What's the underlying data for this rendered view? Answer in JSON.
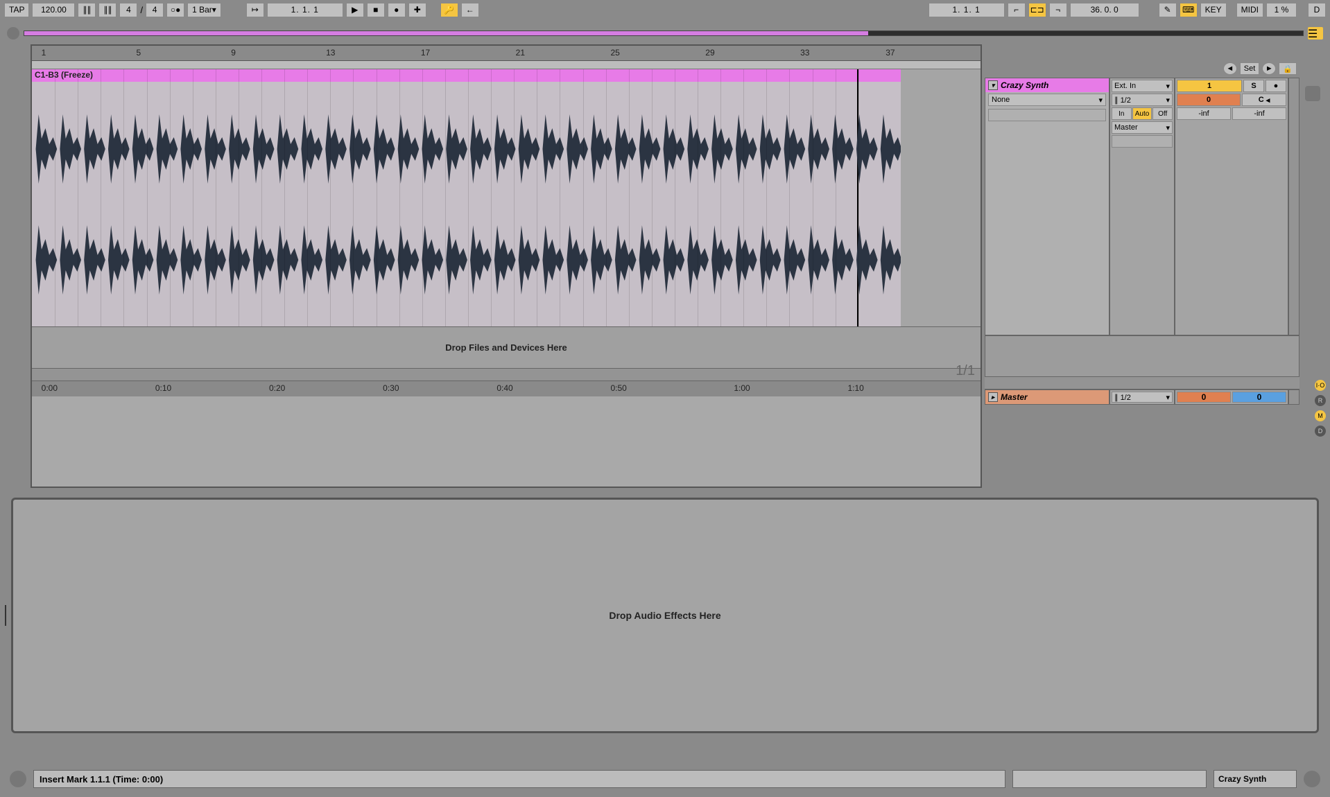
{
  "topbar": {
    "tap": "TAP",
    "tempo": "120.00",
    "sig_num": "4",
    "sig_sep": "/",
    "sig_den": "4",
    "quantize": "1 Bar",
    "position": "1.   1.   1",
    "position2": "1.   1.   1",
    "bars": "36.   0.   0",
    "key": "KEY",
    "midi": "MIDI",
    "pct": "1 %",
    "d": "D"
  },
  "overview": {
    "fill_pct": 66
  },
  "ruler": {
    "marks": [
      "1",
      "5",
      "9",
      "13",
      "17",
      "21",
      "25",
      "29",
      "33",
      "37"
    ]
  },
  "setbar": {
    "set": "Set"
  },
  "track": {
    "clip_name": "C1-B3 (Freeze)",
    "name": "Crazy Synth",
    "routing_select": "None",
    "io_top": "Ext. In",
    "io_ch": "1/2",
    "monitor": {
      "in": "In",
      "auto": "Auto",
      "off": "Off"
    },
    "out": "Master",
    "mixer_1": "1",
    "mixer_0": "0",
    "solo": "S",
    "rec": "●",
    "c": "C",
    "inf1": "-inf",
    "inf2": "-inf"
  },
  "drop1": "Drop Files and Devices Here",
  "page_frac": "1/1",
  "master": {
    "name": "Master",
    "out": "1/2",
    "v1": "0",
    "v2": "0"
  },
  "time_ruler": [
    "0:00",
    "0:10",
    "0:20",
    "0:30",
    "0:40",
    "0:50",
    "1:00",
    "1:10"
  ],
  "side_dots": [
    {
      "label": "I·O",
      "bg": "#f5c542"
    },
    {
      "label": "R",
      "bg": "#555"
    },
    {
      "label": "M",
      "bg": "#f5c542"
    },
    {
      "label": "D",
      "bg": "#555"
    }
  ],
  "fx_drop": "Drop Audio Effects Here",
  "status": {
    "text": "Insert Mark 1.1.1 (Time: 0:00)",
    "track": "Crazy Synth"
  }
}
